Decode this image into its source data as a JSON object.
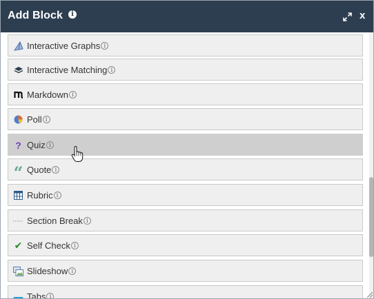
{
  "dialog": {
    "title": "Add Block",
    "info_glyph": "i",
    "close_label": "x",
    "icons": {
      "info": "info-icon",
      "expand": "expand-icon",
      "close": "close-icon",
      "resize": "resize-grip-icon"
    }
  },
  "blocks": [
    {
      "label": "Interactive Graphs",
      "icon": "graph-icon",
      "info": "i"
    },
    {
      "label": "Interactive Matching",
      "icon": "matching-icon",
      "info": "i"
    },
    {
      "label": "Markdown",
      "icon": "markdown-icon",
      "info": "i"
    },
    {
      "label": "Poll",
      "icon": "poll-pie-icon",
      "info": "i"
    },
    {
      "label": "Quiz",
      "icon": "question-icon",
      "info": "i",
      "glyph": "?"
    },
    {
      "label": "Quote",
      "icon": "quote-icon",
      "info": "i",
      "glyph": "“"
    },
    {
      "label": "Rubric",
      "icon": "rubric-grid-icon",
      "info": "i"
    },
    {
      "label": "Section Break",
      "icon": "section-break-icon",
      "info": "i"
    },
    {
      "label": "Self Check",
      "icon": "checkmark-icon",
      "info": "i",
      "glyph": "✔"
    },
    {
      "label": "Slideshow",
      "icon": "slideshow-icon",
      "info": "i"
    },
    {
      "label": "Tabs",
      "icon": "tabs-icon",
      "info": "i"
    }
  ],
  "hovered_block": "Quiz",
  "colors": {
    "header": "#2d3e50",
    "item_bg": "#efefef",
    "item_hover_bg": "#cfcfcf",
    "quiz_icon": "#6a3fb5",
    "quote_icon": "#6aa88f",
    "check_icon": "#2a8a2a"
  }
}
